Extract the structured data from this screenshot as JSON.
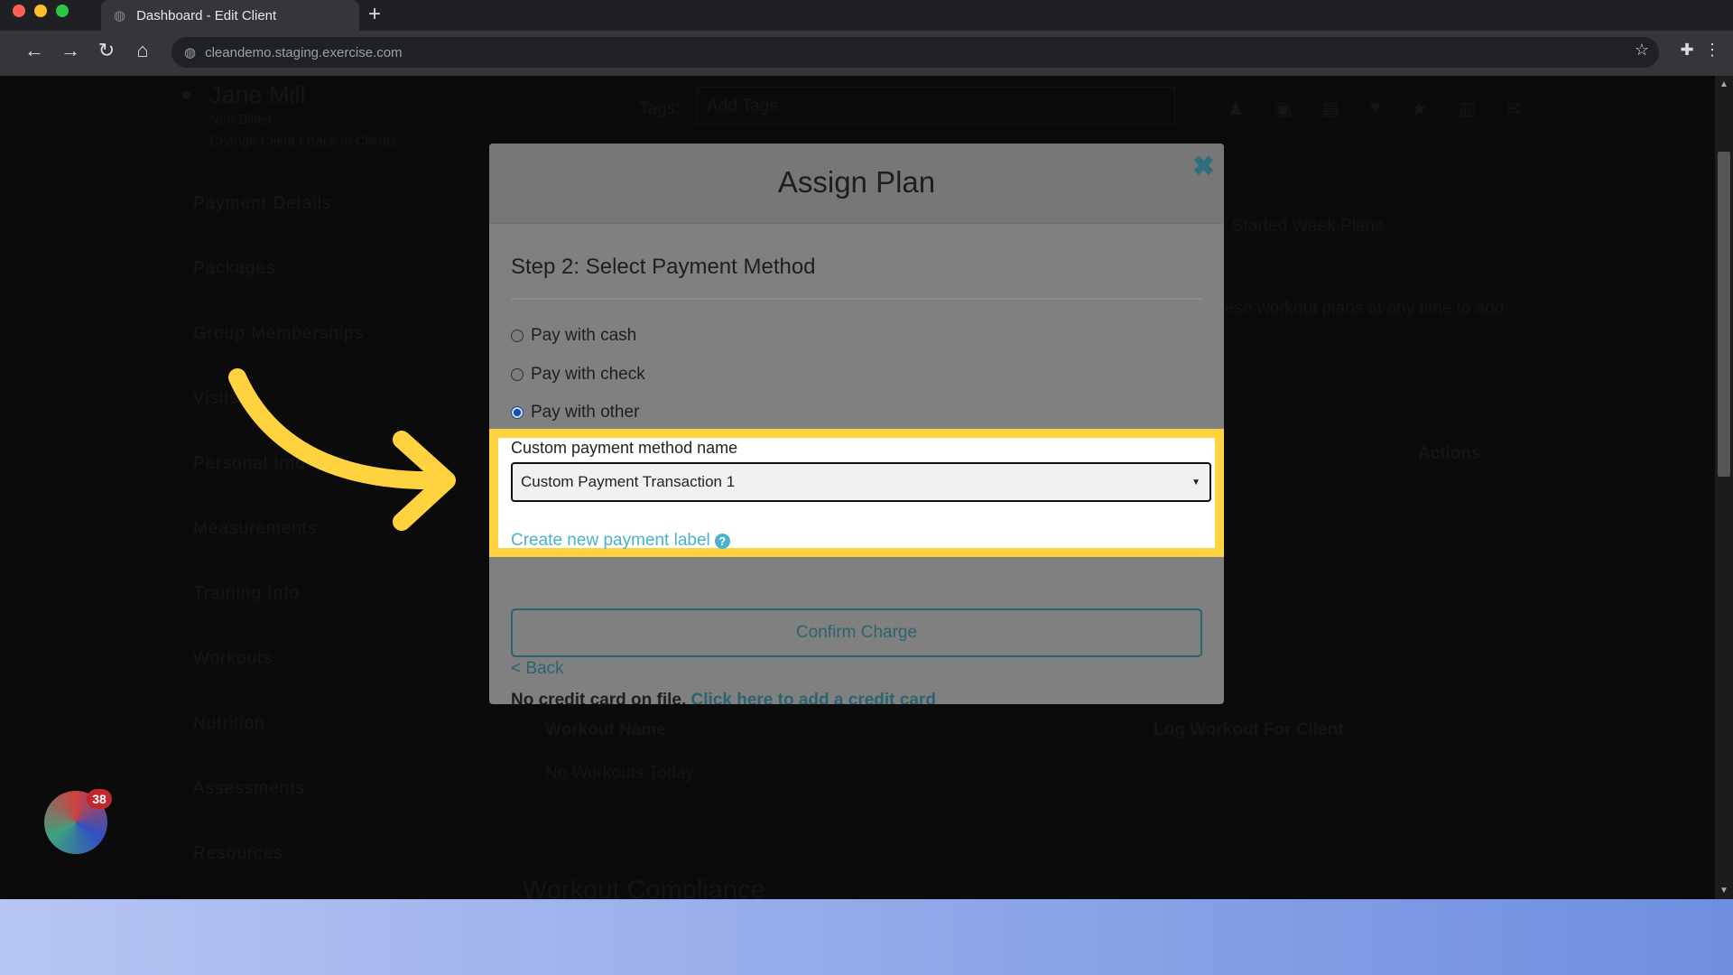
{
  "browser": {
    "tab_title": "Dashboard - Edit Client",
    "url": "cleandemo.staging.exercise.com",
    "new_tab": "+"
  },
  "client": {
    "name": "Jane Mill",
    "status": "Non-Billed",
    "change_client": "Change Client",
    "separator": "/",
    "back_to_clients": "Back to Clients"
  },
  "tags": {
    "label": "Tags:",
    "placeholder": "Add Tags"
  },
  "sidebar": {
    "items": [
      {
        "label": "Payment Details"
      },
      {
        "label": "Packages"
      },
      {
        "label": "Group Memberships"
      },
      {
        "label": "Visits"
      },
      {
        "label": "Personal Info"
      },
      {
        "label": "Measurements"
      },
      {
        "label": "Training Info"
      },
      {
        "label": "Workouts"
      },
      {
        "label": "Nutrition"
      },
      {
        "label": "Assessments"
      },
      {
        "label": "Resources"
      }
    ]
  },
  "background": {
    "started_week_plans": "Started Week Plans",
    "plans_text": "ese workout plans at any time to add",
    "actions": "Actions",
    "workout_name": "Workout Name",
    "log_workout": "Log Workout For Client",
    "no_workouts": "No Workouts Today",
    "workout_compliance": "Workout Compliance"
  },
  "modal": {
    "title": "Assign Plan",
    "step": "Step 2: Select Payment Method",
    "options": [
      {
        "label": "Pay with cash",
        "selected": false
      },
      {
        "label": "Pay with check",
        "selected": false
      },
      {
        "label": "Pay with other",
        "selected": true
      }
    ],
    "custom_label": "Custom payment method name",
    "custom_value": "Custom Payment Transaction 1",
    "create_label": "Create new payment label",
    "no_card": "No credit card on file.",
    "add_card": "Click here to add a credit card",
    "confirm": "Confirm Charge",
    "back": "< Back"
  },
  "widget": {
    "badge": "38"
  },
  "colors": {
    "highlight": "#ffd23f",
    "link": "#4ab3cc",
    "accent": "#2c6370"
  }
}
